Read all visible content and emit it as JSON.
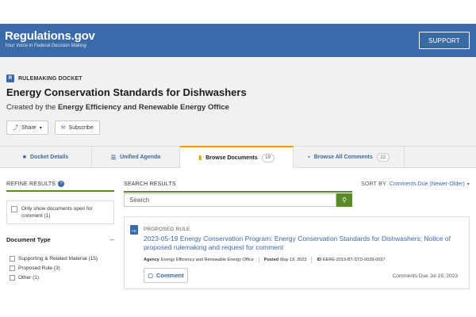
{
  "header": {
    "logo_text": "Regulations.gov",
    "tagline": "Your Voice in Federal Decision Making",
    "support_label": "SUPPORT",
    "brand_color": "#3a6aa8"
  },
  "docket": {
    "type_label": "RULEMAKING DOCKET",
    "type_icon_letter": "R",
    "title": "Energy Conservation Standards for Dishwashers",
    "created_by_prefix": "Created by the",
    "created_by_office": "Energy Efficiency and Renewable Energy Office",
    "share_label": "Share",
    "subscribe_label": "Subscribe"
  },
  "tabs": [
    {
      "label": "Docket Details",
      "icon": "folder-icon"
    },
    {
      "label": "Unified Agenda",
      "icon": "list-icon"
    },
    {
      "label": "Browse Documents",
      "icon": "document-icon",
      "count": "19",
      "active": true
    },
    {
      "label": "Browse All Comments",
      "icon": "comment-icon",
      "count": "22"
    }
  ],
  "refine": {
    "title": "REFINE RESULTS",
    "open_for_comment_label": "Only show documents open for comment",
    "open_for_comment_count": "(1)",
    "document_type_title": "Document Type",
    "collapse_symbol": "–",
    "document_types": [
      {
        "label": "Supporting & Related Material",
        "count": "(15)"
      },
      {
        "label": "Proposed Rule",
        "count": "(3)"
      },
      {
        "label": "Other",
        "count": "(1)"
      }
    ]
  },
  "search": {
    "title": "SEARCH RESULTS",
    "placeholder": "Search",
    "sort_label": "SORT BY",
    "sort_value": "Comments Due (Newer-Older)"
  },
  "result": {
    "type": "PROPOSED RULE",
    "title": "2023-05-19 Energy Conservation Program: Energy Conservation Standards for Dishwashers; Notice of proposed rulemaking and request for comment",
    "agency_label": "Agency",
    "agency_value": "Energy Efficiency and Renewable Energy Office",
    "posted_label": "Posted",
    "posted_value": "May 19, 2023",
    "id_label": "ID",
    "id_value": "EERE-2019-BT-STD-0039-0037",
    "comment_label": "Comment",
    "comments_due": "Comments Due Jul 19, 2023"
  }
}
